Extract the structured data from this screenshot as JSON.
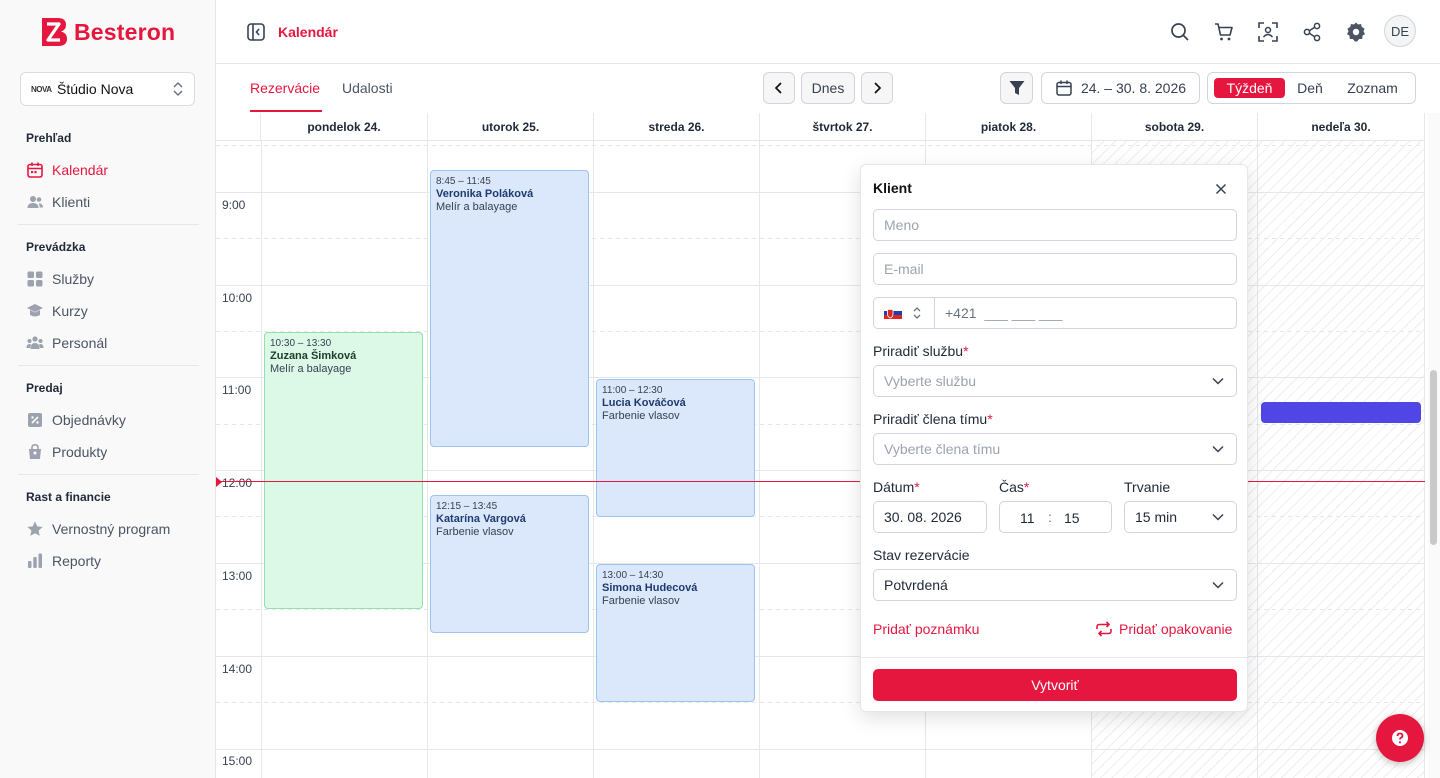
{
  "brand": {
    "name": "Besteron",
    "color": "#e5173f"
  },
  "studio": {
    "logo_text": "NOVA",
    "name": "Štúdio Nova"
  },
  "sidebar": {
    "sections": [
      {
        "title": "Prehľad",
        "items": [
          {
            "label": "Kalendár",
            "icon": "calendar-icon",
            "active": true
          },
          {
            "label": "Klienti",
            "icon": "users-icon"
          }
        ]
      },
      {
        "title": "Prevádzka",
        "items": [
          {
            "label": "Služby",
            "icon": "grid-icon"
          },
          {
            "label": "Kurzy",
            "icon": "graduation-cap-icon"
          },
          {
            "label": "Personál",
            "icon": "staff-icon"
          }
        ]
      },
      {
        "title": "Predaj",
        "items": [
          {
            "label": "Objednávky",
            "icon": "receipt-icon"
          },
          {
            "label": "Produkty",
            "icon": "shopping-bag-icon"
          }
        ]
      },
      {
        "title": "Rast a financie",
        "items": [
          {
            "label": "Vernostný program",
            "icon": "star-icon"
          },
          {
            "label": "Reporty",
            "icon": "bar-chart-icon"
          }
        ]
      }
    ]
  },
  "header": {
    "title": "Kalendár",
    "avatar_initials": "DE"
  },
  "toolbar": {
    "tabs": [
      {
        "label": "Rezervácie",
        "active": true
      },
      {
        "label": "Udalosti"
      }
    ],
    "today_label": "Dnes",
    "date_range": "24. – 30. 8. 2026",
    "views": [
      {
        "label": "Týždeň",
        "active": true
      },
      {
        "label": "Deň"
      },
      {
        "label": "Zoznam"
      }
    ]
  },
  "calendar": {
    "days": [
      "pondelok 24.",
      "utorok 25.",
      "streda 26.",
      "štvrtok 27.",
      "piatok 28.",
      "sobota 29.",
      "nedeľa 30."
    ],
    "hours": [
      "9:00",
      "10:00",
      "11:00",
      "12:00",
      "13:00",
      "14:00",
      "15:00"
    ],
    "events": [
      {
        "time": "8:45 – 11:45",
        "client": "Veronika Poláková",
        "service": "Melír a balayage",
        "color": "blue"
      },
      {
        "time": "10:30 – 13:30",
        "client": "Zuzana Šimková",
        "service": "Melír a balayage",
        "color": "green"
      },
      {
        "time": "11:00 – 12:30",
        "client": "Lucia Kováčová",
        "service": "Farbenie vlasov",
        "color": "blue"
      },
      {
        "time": "12:15 – 13:45",
        "client": "Katarína Vargová",
        "service": "Farbenie vlasov",
        "color": "blue"
      },
      {
        "time": "13:00 – 14:30",
        "client": "Simona Hudecová",
        "service": "Farbenie vlasov",
        "color": "blue"
      }
    ]
  },
  "modal": {
    "title": "Klient",
    "name_placeholder": "Meno",
    "email_placeholder": "E-mail",
    "phone_prefix": "+421",
    "phone_mask": "___ ___ ___",
    "service_label": "Priradiť službu",
    "service_placeholder": "Vyberte službu",
    "staff_label": "Priradiť člena tímu",
    "staff_placeholder": "Vyberte člena tímu",
    "date_label": "Dátum",
    "date_value": "30. 08. 2026",
    "time_label": "Čas",
    "time_hour": "11",
    "time_sep": ":",
    "time_minute": "15",
    "duration_label": "Trvanie",
    "duration_value": "15 min",
    "status_label": "Stav rezervácie",
    "status_value": "Potvrdená",
    "add_note": "Pridať poznámku",
    "add_repeat": "Pridať opakovanie",
    "submit": "Vytvoriť",
    "required_mark": "*"
  }
}
